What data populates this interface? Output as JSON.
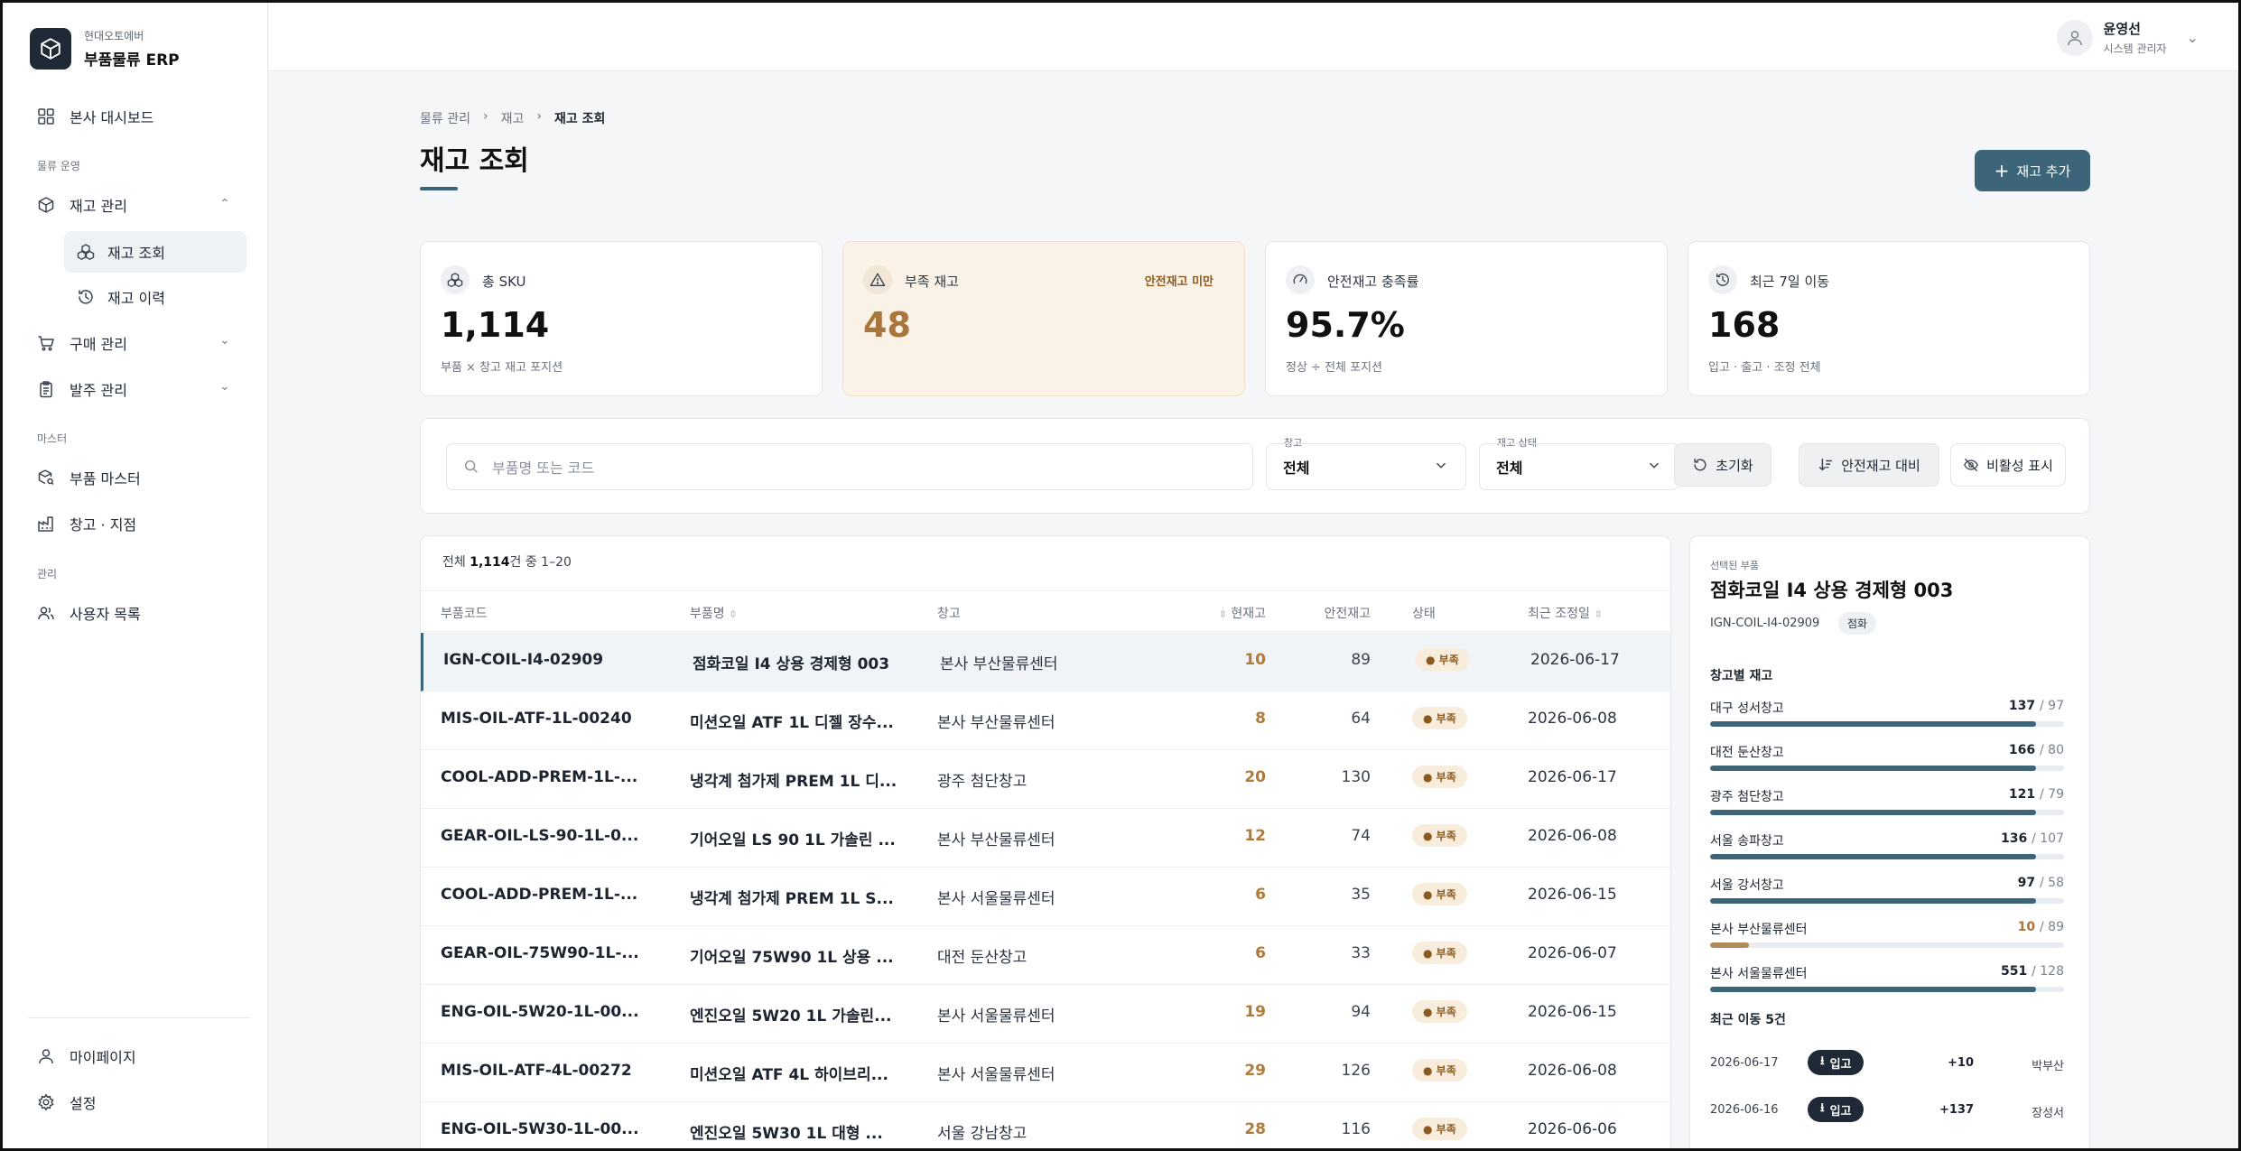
{
  "brand": {
    "company": "현대오토에버",
    "app": "부품물류 ERP"
  },
  "nav": {
    "dashboard": "본사 대시보드",
    "section_ops": "물류 운영",
    "inventory": "재고 관리",
    "inventory_sub": [
      "재고 조회",
      "재고 이력"
    ],
    "purchase": "구매 관리",
    "order": "발주 관리",
    "section_master": "마스터",
    "parts_master": "부품 마스터",
    "warehouse": "창고 · 지점",
    "section_admin": "관리",
    "users": "사용자 목록",
    "mypage": "마이페이지",
    "settings": "설정"
  },
  "user": {
    "name": "윤영선",
    "role": "시스템 관리자"
  },
  "breadcrumb": [
    "물류 관리",
    "재고",
    "재고 조회"
  ],
  "page_title": "재고 조회",
  "add_button": "재고 추가",
  "kpis": [
    {
      "label": "총 SKU",
      "value": "1,114",
      "desc": "부품 × 창고 재고 포지션",
      "icon": "boxes-icon"
    },
    {
      "label": "부족 재고",
      "value": "48",
      "desc": "",
      "badge": "안전재고 미만",
      "icon": "alert-icon"
    },
    {
      "label": "안전재고 충족률",
      "value": "95.7%",
      "desc": "정상 ÷ 전체 포지션",
      "icon": "gauge-icon"
    },
    {
      "label": "최근 7일 이동",
      "value": "168",
      "desc": "입고 · 출고 · 조정 전체",
      "icon": "history-icon"
    }
  ],
  "filter": {
    "search_placeholder": "부품명 또는 코드",
    "warehouse_label": "창고",
    "warehouse_value": "전체",
    "status_label": "재고 상태",
    "status_value": "전체",
    "reset": "초기화",
    "sort_safety": "안전재고 대비",
    "show_inactive": "비활성 표시"
  },
  "table": {
    "count_prefix": "전체",
    "count_total": "1,114",
    "count_suffix": "건 중 1–20",
    "columns": [
      "부품코드",
      "부품명",
      "창고",
      "현재고",
      "안전재고",
      "상태",
      "최근 조정일"
    ],
    "rows": [
      {
        "code": "IGN-COIL-I4-02909",
        "name": "점화코일 I4 상용 경제형 003",
        "warehouse": "본사 부산물류센터",
        "qty": "10",
        "safety": "89",
        "status": "● 부족",
        "date": "2026-06-17"
      },
      {
        "code": "MIS-OIL-ATF-1L-00240",
        "name": "미션오일 ATF 1L 디젤 장수...",
        "warehouse": "본사 부산물류센터",
        "qty": "8",
        "safety": "64",
        "status": "● 부족",
        "date": "2026-06-08"
      },
      {
        "code": "COOL-ADD-PREM-1L-...",
        "name": "냉각계 첨가제 PREM 1L 디...",
        "warehouse": "광주 첨단창고",
        "qty": "20",
        "safety": "130",
        "status": "● 부족",
        "date": "2026-06-17"
      },
      {
        "code": "GEAR-OIL-LS-90-1L-0...",
        "name": "기어오일 LS 90 1L 가솔린 ...",
        "warehouse": "본사 부산물류센터",
        "qty": "12",
        "safety": "74",
        "status": "● 부족",
        "date": "2026-06-08"
      },
      {
        "code": "COOL-ADD-PREM-1L-...",
        "name": "냉각계 첨가제 PREM 1L S...",
        "warehouse": "본사 서울물류센터",
        "qty": "6",
        "safety": "35",
        "status": "● 부족",
        "date": "2026-06-15"
      },
      {
        "code": "GEAR-OIL-75W90-1L-...",
        "name": "기어오일 75W90 1L 상용 ...",
        "warehouse": "대전 둔산창고",
        "qty": "6",
        "safety": "33",
        "status": "● 부족",
        "date": "2026-06-07"
      },
      {
        "code": "ENG-OIL-5W20-1L-00...",
        "name": "엔진오일 5W20 1L 가솔린...",
        "warehouse": "본사 서울물류센터",
        "qty": "19",
        "safety": "94",
        "status": "● 부족",
        "date": "2026-06-15"
      },
      {
        "code": "MIS-OIL-ATF-4L-00272",
        "name": "미션오일 ATF 4L 하이브리...",
        "warehouse": "본사 서울물류센터",
        "qty": "29",
        "safety": "126",
        "status": "● 부족",
        "date": "2026-06-08"
      },
      {
        "code": "ENG-OIL-5W30-1L-00...",
        "name": "엔진오일 5W30 1L 대형 ...",
        "warehouse": "서울 강남창고",
        "qty": "28",
        "safety": "116",
        "status": "● 부족",
        "date": "2026-06-06"
      }
    ]
  },
  "panel": {
    "label": "선택된 부품",
    "title": "점화코일 I4 상용 경제형 003",
    "code": "IGN-COIL-I4-02909",
    "category": "점화",
    "stock_title": "창고별 재고",
    "warehouses": [
      {
        "name": "대구 성서창고",
        "qty": "137",
        "safety": "/ 97",
        "fill": 0.92,
        "low": false
      },
      {
        "name": "대전 둔산창고",
        "qty": "166",
        "safety": "/ 80",
        "fill": 0.92,
        "low": false
      },
      {
        "name": "광주 첨단창고",
        "qty": "121",
        "safety": "/ 79",
        "fill": 0.92,
        "low": false
      },
      {
        "name": "서울 송파창고",
        "qty": "136",
        "safety": "/ 107",
        "fill": 0.92,
        "low": false
      },
      {
        "name": "서울 강서창고",
        "qty": "97",
        "safety": "/ 58",
        "fill": 0.92,
        "low": false
      },
      {
        "name": "본사 부산물류센터",
        "qty": "10",
        "safety": "/ 89",
        "fill": 0.11,
        "low": true
      },
      {
        "name": "본사 서울물류센터",
        "qty": "551",
        "safety": "/ 128",
        "fill": 0.92,
        "low": false
      }
    ],
    "moves_title": "최근 이동 5건",
    "moves": [
      {
        "date": "2026-06-17",
        "type": "입고",
        "qty": "+10",
        "user": "박부산"
      },
      {
        "date": "2026-06-16",
        "type": "입고",
        "qty": "+137",
        "user": "장성서"
      }
    ]
  }
}
